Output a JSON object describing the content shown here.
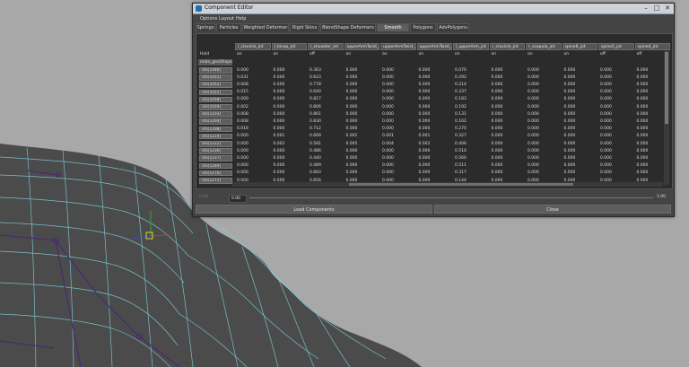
{
  "window": {
    "title": "Component Editor",
    "menu": [
      "Options",
      "Layout",
      "Help"
    ],
    "tabs": [
      {
        "label": "Springs",
        "active": false
      },
      {
        "label": "Particles",
        "active": false
      },
      {
        "label": "Weighted Deformer",
        "active": false
      },
      {
        "label": "Rigid Skins",
        "active": false
      },
      {
        "label": "BlendShape Deformers",
        "active": false
      },
      {
        "label": "Smooth Skins",
        "active": true
      },
      {
        "label": "Polygons",
        "active": false
      },
      {
        "label": "AdvPolygons",
        "active": false
      }
    ],
    "columns": [
      "l_clavicle_jnt",
      "l_bicep_jnt",
      "l_shoulder_jnt",
      "upperArmTwist_jnt",
      "upperArmTwist_jnt",
      "upperArmTwist_jnt",
      "l_upperArm_jnt",
      "r_clavicle_jnt",
      "r_scapula_jnt",
      "spine6_jnt",
      "spine5_jnt",
      "spine4_jnt"
    ],
    "hold_label": "Hold",
    "hold_values": [
      "on",
      "on",
      "off",
      "on",
      "on",
      "on",
      "on",
      "on",
      "on",
      "on",
      "off",
      "off"
    ],
    "shape_label": "male_geoShape",
    "rows": [
      {
        "label": "vtx[1046]",
        "values": [
          "0.000",
          "0.000",
          "0.363",
          "0.000",
          "0.000",
          "0.000",
          "0.070",
          "0.000",
          "0.000",
          "0.000",
          "0.000",
          "0.000"
        ]
      },
      {
        "label": "vtx[1051]",
        "values": [
          "0.031",
          "0.000",
          "0.623",
          "0.000",
          "0.000",
          "0.000",
          "0.292",
          "0.000",
          "0.000",
          "0.000",
          "0.000",
          "0.000"
        ]
      },
      {
        "label": "vtx[1052]",
        "values": [
          "0.008",
          "0.000",
          "0.778",
          "0.000",
          "0.000",
          "0.000",
          "0.214",
          "0.000",
          "0.000",
          "0.000",
          "0.000",
          "0.000"
        ]
      },
      {
        "label": "vtx[1055]",
        "values": [
          "0.015",
          "0.000",
          "0.640",
          "0.000",
          "0.000",
          "0.000",
          "0.337",
          "0.000",
          "0.000",
          "0.000",
          "0.000",
          "0.000"
        ]
      },
      {
        "label": "vtx[1058]",
        "values": [
          "0.000",
          "0.000",
          "0.817",
          "0.000",
          "0.000",
          "0.000",
          "0.183",
          "0.000",
          "0.000",
          "0.000",
          "0.000",
          "0.000"
        ]
      },
      {
        "label": "vtx[1059]",
        "values": [
          "0.002",
          "0.000",
          "0.806",
          "0.000",
          "0.000",
          "0.000",
          "0.192",
          "0.000",
          "0.000",
          "0.000",
          "0.000",
          "0.000"
        ]
      },
      {
        "label": "vtx[1103]",
        "values": [
          "0.008",
          "0.000",
          "0.861",
          "0.000",
          "0.000",
          "0.000",
          "0.131",
          "0.000",
          "0.000",
          "0.000",
          "0.000",
          "0.000"
        ]
      },
      {
        "label": "vtx[1204]",
        "values": [
          "0.008",
          "0.000",
          "0.830",
          "0.000",
          "0.000",
          "0.000",
          "0.162",
          "0.000",
          "0.000",
          "0.000",
          "0.000",
          "0.000"
        ]
      },
      {
        "label": "vtx[1208]",
        "values": [
          "0.018",
          "0.000",
          "0.712",
          "0.000",
          "0.000",
          "0.000",
          "0.270",
          "0.000",
          "0.000",
          "0.000",
          "0.000",
          "0.000"
        ]
      },
      {
        "label": "vtx[1214]",
        "values": [
          "0.000",
          "0.001",
          "0.669",
          "0.002",
          "0.001",
          "0.001",
          "0.327",
          "0.000",
          "0.000",
          "0.000",
          "0.000",
          "0.000"
        ]
      },
      {
        "label": "vtx[1222]",
        "values": [
          "0.000",
          "0.002",
          "0.581",
          "0.005",
          "0.004",
          "0.002",
          "0.406",
          "0.000",
          "0.000",
          "0.000",
          "0.000",
          "0.000"
        ]
      },
      {
        "label": "vtx[1236]",
        "values": [
          "0.000",
          "0.000",
          "0.486",
          "0.000",
          "0.000",
          "0.000",
          "0.514",
          "0.000",
          "0.000",
          "0.000",
          "0.000",
          "0.000"
        ]
      },
      {
        "label": "vtx[1237]",
        "values": [
          "0.000",
          "0.000",
          "0.440",
          "0.000",
          "0.000",
          "0.000",
          "0.560",
          "0.000",
          "0.000",
          "0.000",
          "0.000",
          "0.000"
        ]
      },
      {
        "label": "vtx[1269]",
        "values": [
          "0.000",
          "0.000",
          "0.489",
          "0.000",
          "0.000",
          "0.000",
          "0.511",
          "0.000",
          "0.000",
          "0.000",
          "0.000",
          "0.000"
        ]
      },
      {
        "label": "vtx[1270]",
        "values": [
          "0.000",
          "0.000",
          "0.683",
          "0.000",
          "0.000",
          "0.000",
          "0.317",
          "0.000",
          "0.000",
          "0.000",
          "0.000",
          "0.000"
        ]
      },
      {
        "label": "vtx[1271]",
        "values": [
          "0.000",
          "0.000",
          "0.856",
          "0.000",
          "0.000",
          "0.000",
          "0.144",
          "0.000",
          "0.000",
          "0.000",
          "0.000",
          "0.000"
        ]
      }
    ],
    "slider": {
      "left_value": "0.00",
      "right_value": "1.00"
    },
    "load_button": "Load Components",
    "close_button": "Close"
  },
  "colors": {
    "viewport_bg": "#a8a8a8",
    "mesh_fill": "#4b4b4b",
    "wire_cyan": "#7fd3e0",
    "joint_purple": "#4a2a70",
    "window_bg": "#444444",
    "titlebar": "#ccd2d8"
  }
}
